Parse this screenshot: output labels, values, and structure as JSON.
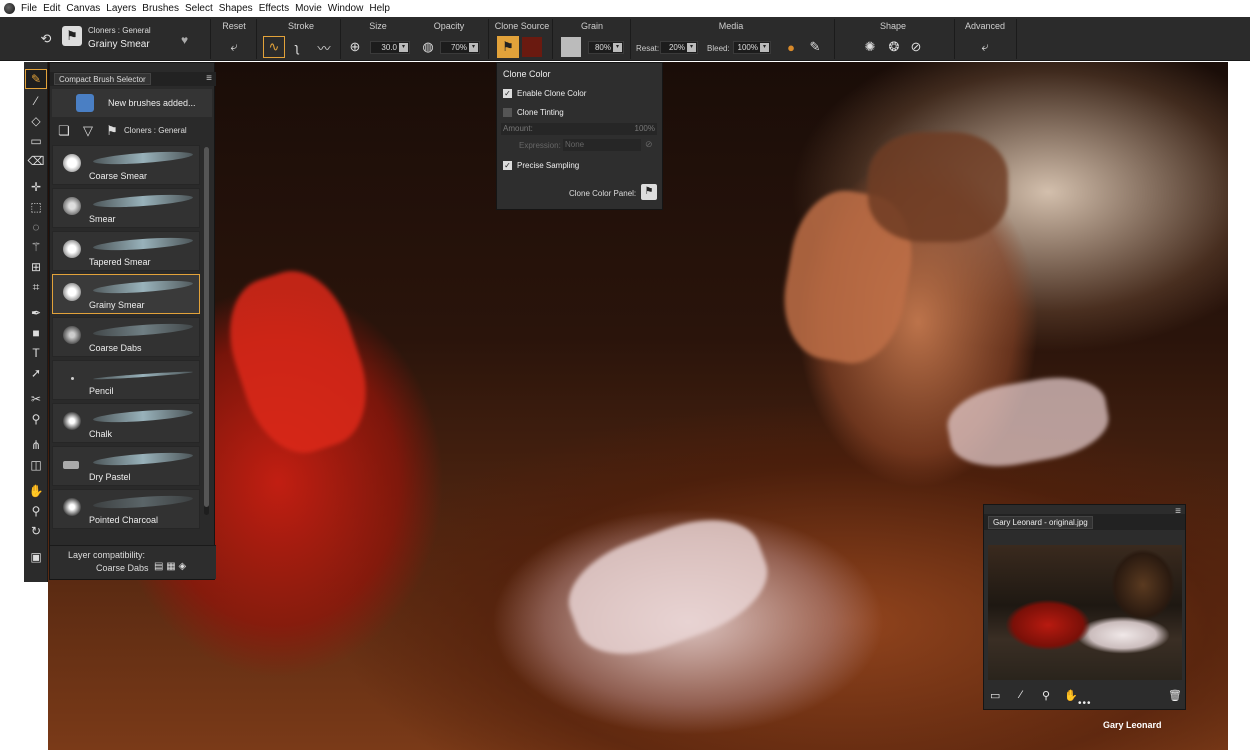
{
  "menubar": {
    "items": [
      "File",
      "Edit",
      "Canvas",
      "Layers",
      "Brushes",
      "Select",
      "Shapes",
      "Effects",
      "Movie",
      "Window",
      "Help"
    ]
  },
  "propbar": {
    "brush_category": "Cloners : General",
    "brush_variant": "Grainy Smear",
    "groups": {
      "reset": "Reset",
      "stroke": "Stroke",
      "size": "Size",
      "opacity": "Opacity",
      "clone_source": "Clone Source",
      "grain": "Grain",
      "media": "Media",
      "shape": "Shape",
      "advanced": "Advanced"
    },
    "size_value": "30.0",
    "opacity_value": "70%",
    "grain_value": "80%",
    "resat_label": "Resat:",
    "resat_value": "20%",
    "bleed_label": "Bleed:",
    "bleed_value": "100%"
  },
  "brush_panel": {
    "tab_title": "Compact Brush Selector",
    "news_text": "New brushes added...",
    "category_label": "Cloners : General",
    "variants": [
      "Coarse Smear",
      "Smear",
      "Tapered Smear",
      "Grainy Smear",
      "Coarse Dabs",
      "Pencil",
      "Chalk",
      "Dry Pastel",
      "Pointed Charcoal"
    ],
    "selected_variant": "Grainy Smear",
    "footer_line1": "Layer compatibility:",
    "footer_line2": "Coarse Dabs"
  },
  "clone_color": {
    "title": "Clone Color",
    "enable_label": "Enable Clone Color",
    "enable_checked": true,
    "tinting_label": "Clone Tinting",
    "tinting_checked": false,
    "amount_label": "Amount:",
    "amount_value": "100%",
    "expression_label": "Expression:",
    "expression_value": "None",
    "precise_label": "Precise Sampling",
    "precise_checked": true,
    "panel_label": "Clone Color Panel:"
  },
  "reference_panel": {
    "tab_title": "Gary Leonard - original.jpg"
  },
  "credit": "Gary Leonard",
  "colors": {
    "accent": "#e2a23a",
    "panel_bg": "#2b2b2b"
  }
}
